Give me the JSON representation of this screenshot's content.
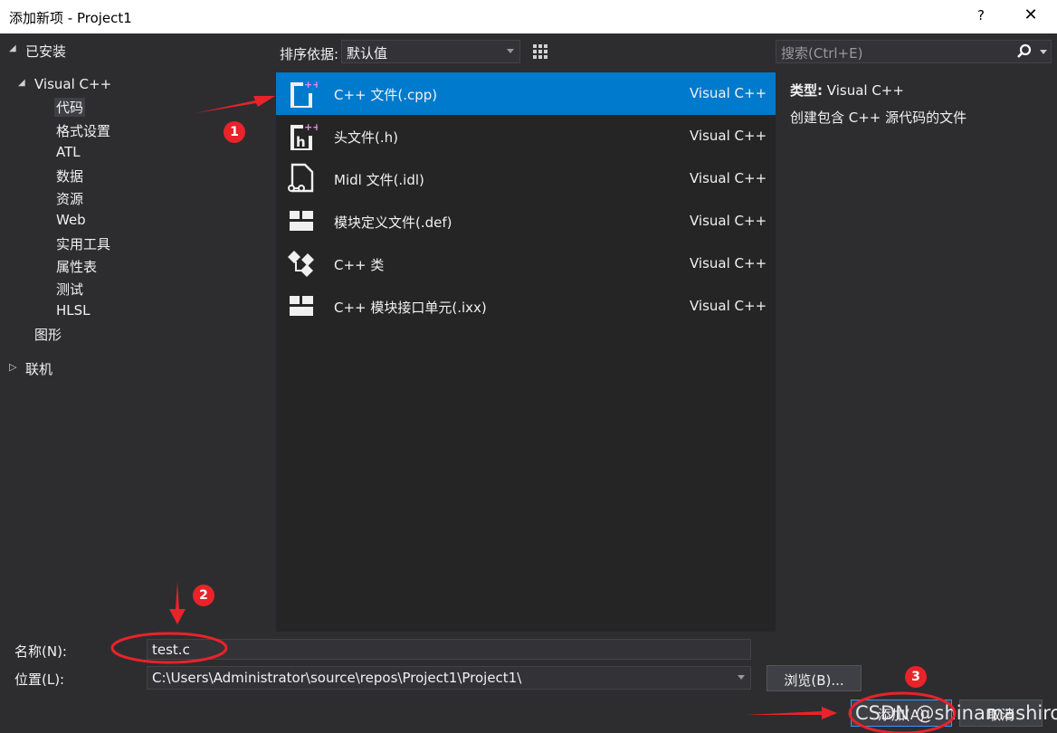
{
  "window": {
    "title": "添加新项 - Project1",
    "help": "?",
    "close": "✕"
  },
  "tree": {
    "installed": "已安装",
    "visual_cpp": "Visual C++",
    "children": [
      "代码",
      "格式设置",
      "ATL",
      "数据",
      "资源",
      "Web",
      "实用工具",
      "属性表",
      "测试",
      "HLSL"
    ],
    "graphics": "图形",
    "online": "联机"
  },
  "toolbar": {
    "sort_label": "排序依据:",
    "sort_value": "默认值"
  },
  "search": {
    "placeholder": "搜索(Ctrl+E)"
  },
  "templates": [
    {
      "name": "C++ 文件(.cpp)",
      "lang": "Visual C++",
      "icon": "cpp-file-icon"
    },
    {
      "name": "头文件(.h)",
      "lang": "Visual C++",
      "icon": "header-file-icon"
    },
    {
      "name": "Midl 文件(.idl)",
      "lang": "Visual C++",
      "icon": "midl-file-icon"
    },
    {
      "name": "模块定义文件(.def)",
      "lang": "Visual C++",
      "icon": "module-def-icon"
    },
    {
      "name": "C++ 类",
      "lang": "Visual C++",
      "icon": "cpp-class-icon"
    },
    {
      "name": "C++ 模块接口单元(.ixx)",
      "lang": "Visual C++",
      "icon": "module-interface-icon"
    }
  ],
  "detail": {
    "type_label": "类型:",
    "type_value": "Visual C++",
    "description": "创建包含 C++ 源代码的文件"
  },
  "form": {
    "name_label": "名称(N):",
    "name_value": "test.c",
    "location_label": "位置(L):",
    "location_value": "C:\\Users\\Administrator\\source\\repos\\Project1\\Project1\\",
    "browse": "浏览(B)...",
    "add": "添加(A)",
    "cancel": "取消"
  },
  "watermark": "CSDN @shinamashiro_",
  "annotations": [
    "1",
    "2",
    "3"
  ],
  "colors": {
    "selection": "#007acc",
    "annotation": "#e8232a",
    "accent_border": "#3399ff"
  }
}
